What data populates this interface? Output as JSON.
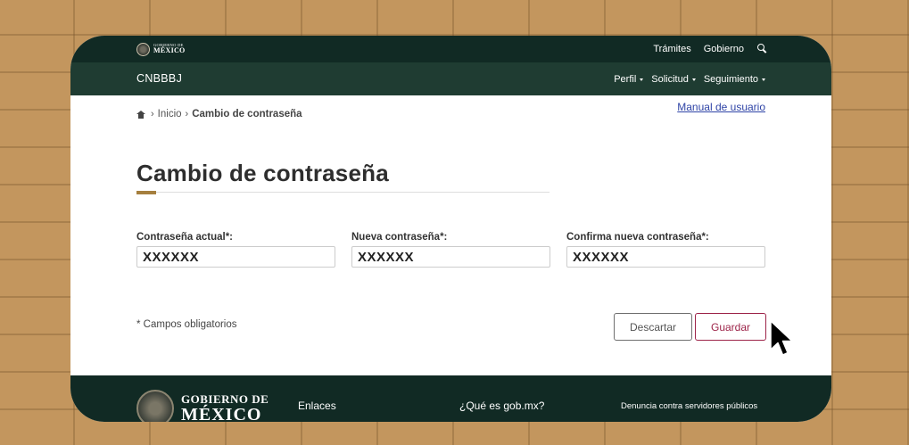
{
  "topbar": {
    "logo_line1": "GOBIERNO DE",
    "logo_line2": "MÉXICO",
    "links": [
      "Trámites",
      "Gobierno"
    ],
    "search_icon": "search-icon"
  },
  "navbar": {
    "brand": "CNBBBJ",
    "menu": [
      "Perfil",
      "Solicitud",
      "Seguimiento"
    ]
  },
  "breadcrumb": {
    "home_icon": "home-icon",
    "separator": "›",
    "items": [
      "Inicio",
      "Cambio de contraseña"
    ]
  },
  "manual_link": "Manual de usuario",
  "page_title": "Cambio de contraseña",
  "form": {
    "fields": [
      {
        "label": "Contraseña actual*:",
        "value": "XXXXXX"
      },
      {
        "label": "Nueva contraseña*:",
        "value": "XXXXXX"
      },
      {
        "label": "Confirma nueva contraseña*:",
        "value": "XXXXXX"
      }
    ],
    "required_note": "* Campos obligatorios",
    "discard_label": "Descartar",
    "save_label": "Guardar"
  },
  "footer": {
    "logo_line1": "GOBIERNO DE",
    "logo_line2": "MÉXICO",
    "links": [
      "Enlaces",
      "¿Qué es gob.mx?",
      "Denuncia contra servidores públicos"
    ]
  },
  "colors": {
    "background": "#c3965e",
    "topbar": "#112a24",
    "navbar": "#1f3c32",
    "accent_gold": "#a57f3e",
    "save_button": "#9d2449",
    "link": "#2e43a6"
  }
}
